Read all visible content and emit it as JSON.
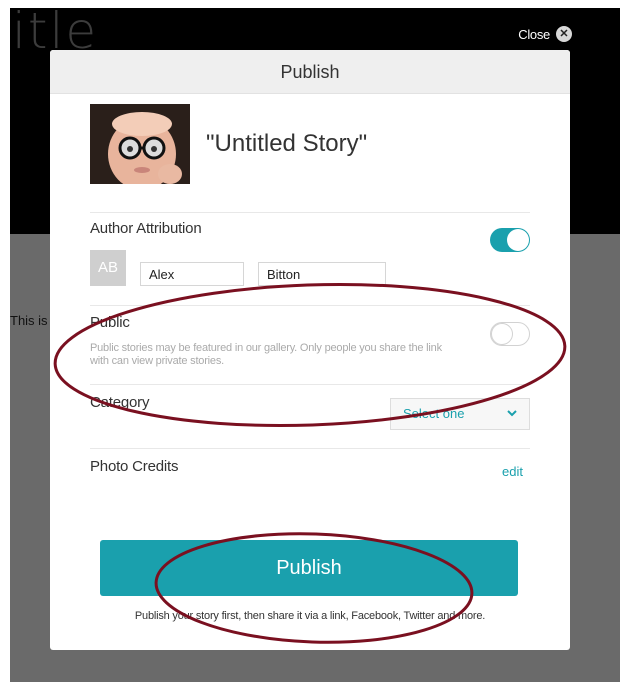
{
  "background": {
    "title_fragment": "itle",
    "text_fragment": "This is"
  },
  "close": {
    "label": "Close",
    "icon": "close-icon"
  },
  "modal": {
    "title": "Publish",
    "story": {
      "title": "\"Untitled Story\""
    },
    "author": {
      "label": "Author Attribution",
      "initials": "AB",
      "first_name": "Alex",
      "last_name": "Bitton",
      "enabled": true
    },
    "public": {
      "label": "Public",
      "description": "Public stories may be featured in our gallery. Only people you share the link with can view private stories.",
      "enabled": false
    },
    "category": {
      "label": "Category",
      "selected": "Select one",
      "icon": "chevron-down-icon"
    },
    "photo_credits": {
      "label": "Photo Credits",
      "edit_label": "edit"
    },
    "publish_button": "Publish",
    "hint": "Publish your story first, then share it via a link, Facebook, Twitter and more."
  },
  "colors": {
    "accent": "#1aa0ad",
    "annotation": "#7a1020",
    "backdrop_dark": "#000000",
    "backdrop_gray": "#6a6a6a"
  }
}
